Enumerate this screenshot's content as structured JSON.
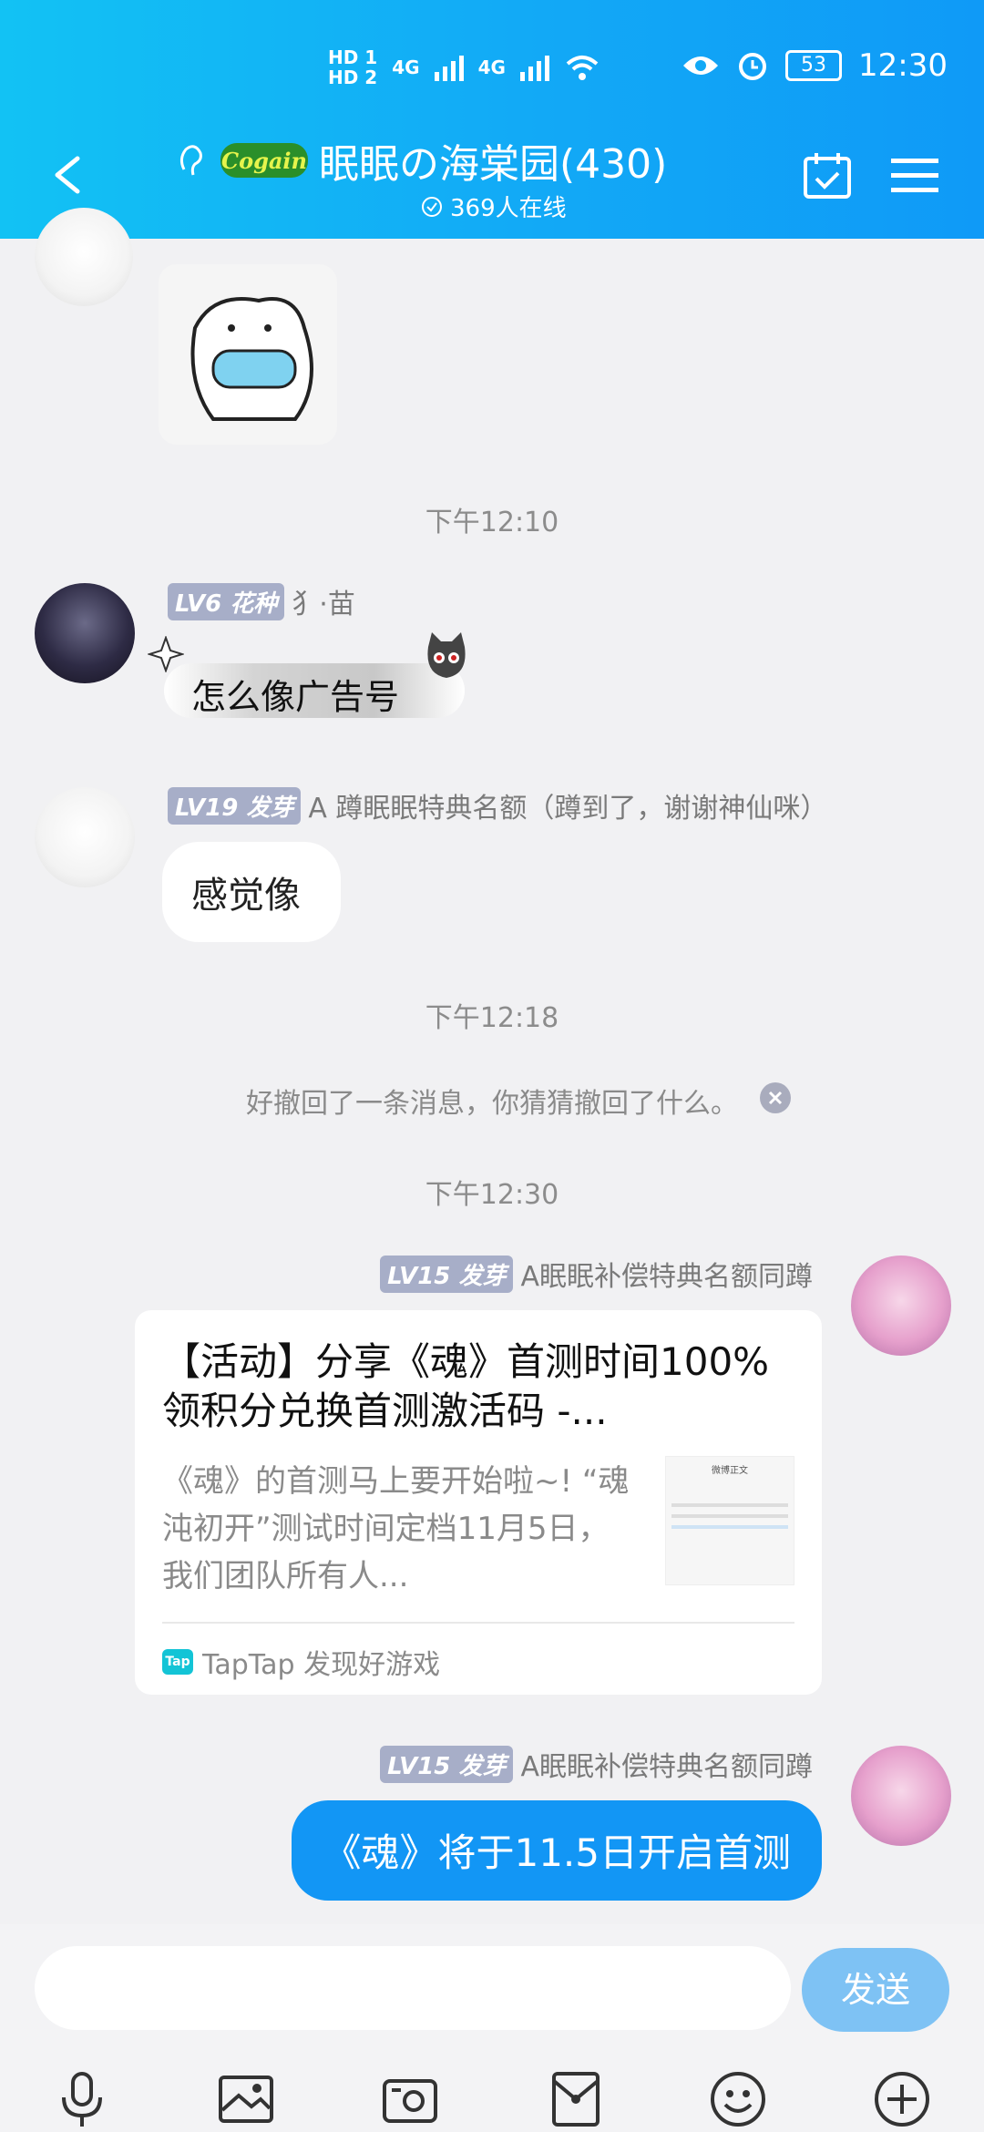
{
  "status": {
    "sim1": "HD 1",
    "sim2": "HD 2",
    "net1": "4G",
    "net2": "4G",
    "battery": "53",
    "time": "12:30"
  },
  "header": {
    "title": "眠眠の海棠园(430)",
    "online": "369人在线",
    "logo_text": "Cogain"
  },
  "messages": {
    "t1": "下午12:10",
    "m1": {
      "level": "LV6",
      "rank": "花种",
      "name": "犭·苗",
      "sticker_text": "怎么像广告号"
    },
    "m2": {
      "level": "LV19",
      "rank": "发芽",
      "name": "A 蹲眠眠特典名额（蹲到了，谢谢神仙咪）",
      "text": "感觉像"
    },
    "t2": "下午12:18",
    "recall": "好撤回了一条消息，你猜猜撤回了什么。",
    "t3": "下午12:30",
    "m3": {
      "level": "LV15",
      "rank": "发芽",
      "name": "A眠眠补偿特典名额同蹲",
      "card_title": "【活动】分享《魂》首测时间100%领积分兑换首测激活码 -...",
      "card_desc": "《魂》的首测马上要开始啦~! “魂沌初开”测试时间定档11月5日，我们团队所有人...",
      "card_source": "TapTap 发现好游戏",
      "tap_logo": "Tap",
      "thumb_header": "微博正文"
    },
    "m4": {
      "level": "LV15",
      "rank": "发芽",
      "name": "A眠眠补偿特典名额同蹲",
      "text": "《魂》将于11.5日开启首测"
    }
  },
  "input": {
    "placeholder": "",
    "send": "发送"
  },
  "tool_icons": [
    "mic-icon",
    "image-icon",
    "camera-icon",
    "red-packet-icon",
    "emoji-icon",
    "plus-icon"
  ]
}
